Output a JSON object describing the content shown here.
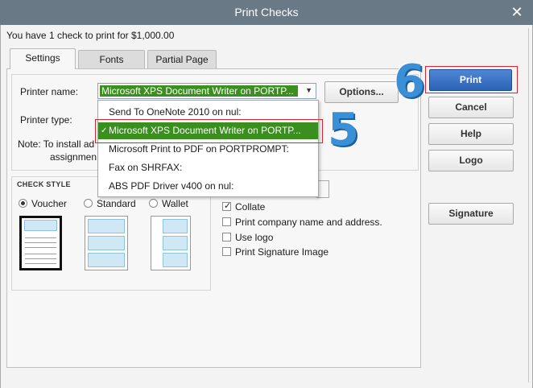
{
  "window": {
    "title": "Print Checks"
  },
  "intro_text": "You have 1 check to print for $1,000.00",
  "tabs": [
    {
      "label": "Settings",
      "active": true
    },
    {
      "label": "Fonts",
      "active": false
    },
    {
      "label": "Partial Page",
      "active": false
    }
  ],
  "printer": {
    "name_label": "Printer name:",
    "selected": "Microsoft XPS Document Writer on PORTP...",
    "type_label": "Printer type:",
    "note_line1": "Note: To install ad",
    "note_line2": "assignmen"
  },
  "dropdown_options": [
    "Send To OneNote 2010 on nul:",
    "Microsoft XPS Document Writer on PORTP...",
    "Microsoft Print to PDF on PORTPROMPT:",
    "Fax on SHRFAX:",
    "ABS PDF Driver v400 on nul:"
  ],
  "selected_option_index": 1,
  "buttons": {
    "options": "Options...",
    "print": "Print",
    "cancel": "Cancel",
    "help": "Help",
    "logo": "Logo",
    "signature": "Signature"
  },
  "check_style": {
    "heading": "CHECK STYLE",
    "options": [
      "Voucher",
      "Standard",
      "Wallet"
    ],
    "selected": "Voucher"
  },
  "print_options": [
    {
      "label": "Collate",
      "checked": true
    },
    {
      "label": "Print company name and address.",
      "checked": false
    },
    {
      "label": "Use logo",
      "checked": false
    },
    {
      "label": "Print Signature Image",
      "checked": false
    }
  ],
  "annotations": {
    "step_print": "6",
    "step_dropdown": "5"
  },
  "colors": {
    "highlight": "#d9252f",
    "selection": "#3a8f1f",
    "primary": "#2c63b6"
  }
}
